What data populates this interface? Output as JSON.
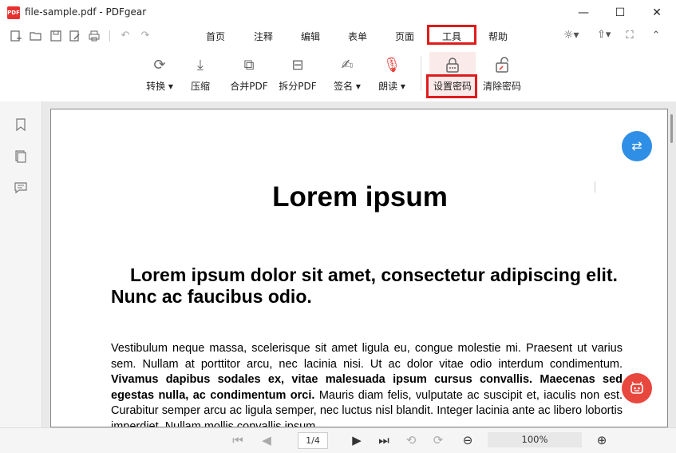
{
  "window": {
    "title": "file-sample.pdf - PDFgear",
    "logo_text": "PDF",
    "minimize": "—",
    "maximize": "☐",
    "close": "✕"
  },
  "quick_icons": [
    "new-file-icon",
    "open-folder-icon",
    "save-icon",
    "save-as-icon",
    "print-icon",
    "undo-icon",
    "redo-icon"
  ],
  "menu": {
    "tabs": [
      "首页",
      "注释",
      "编辑",
      "表单",
      "页面",
      "工具",
      "帮助"
    ],
    "active": "工具"
  },
  "ribbon": {
    "items": [
      {
        "label": "转换 ▾",
        "icon": "convert-icon"
      },
      {
        "label": "压缩",
        "icon": "compress-icon"
      },
      {
        "label": "合并PDF",
        "icon": "merge-pdf-icon"
      },
      {
        "label": "拆分PDF",
        "icon": "split-pdf-icon"
      },
      {
        "label": "签名 ▾",
        "icon": "signature-icon"
      },
      {
        "label": "朗读 ▾",
        "icon": "read-aloud-icon"
      },
      {
        "label": "设置密码",
        "icon": "lock-icon"
      },
      {
        "label": "清除密码",
        "icon": "unlock-icon"
      }
    ]
  },
  "document": {
    "heading1": "Lorem ipsum",
    "heading2": "Lorem ipsum dolor sit amet, consectetur adipiscing elit. Nunc ac faucibus odio.",
    "para_part1": "Vestibulum neque massa, scelerisque sit amet ligula eu, congue molestie mi. Praesent ut varius sem. Nullam at porttitor arcu, nec lacinia nisi. Ut ac dolor vitae odio interdum condimentum. ",
    "para_bold": "Vivamus dapibus sodales ex, vitae malesuada ipsum cursus convallis. Maecenas sed egestas nulla, ac condimentum orci.",
    "para_part2": " Mauris diam felis, vulputate ac suscipit et, iaculis non est. Curabitur semper arcu ac ligula semper, nec luctus nisl blandit. Integer lacinia ante ac libero lobortis imperdiet. Nullam mollis convallis ipsum."
  },
  "bottom": {
    "page_value": "1/4",
    "zoom_value": "100%"
  }
}
